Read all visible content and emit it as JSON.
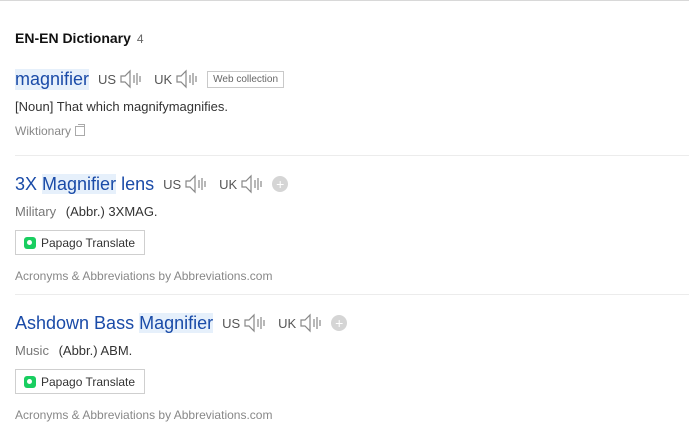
{
  "section": {
    "title": "EN-EN Dictionary",
    "count": "4"
  },
  "entries": [
    {
      "headword": "magnifier",
      "us_label": "US",
      "uk_label": "UK",
      "badge": "Web collection",
      "pos": "[Noun]",
      "definition": "That which magnifymagnifies.",
      "source": "Wiktionary"
    },
    {
      "headword_pre": "3X ",
      "headword_hl": "Magnifier",
      "headword_post": " lens",
      "us_label": "US",
      "uk_label": "UK",
      "plus": "+",
      "field": "Military",
      "definition": "(Abbr.) 3XMAG.",
      "papago": "Papago Translate",
      "provider": "Acronyms & Abbreviations by Abbreviations.com"
    },
    {
      "headword_pre": "Ashdown Bass ",
      "headword_hl": "Magnifier",
      "headword_post": "",
      "us_label": "US",
      "uk_label": "UK",
      "plus": "+",
      "field": "Music",
      "definition": "(Abbr.) ABM.",
      "papago": "Papago Translate",
      "provider": "Acronyms & Abbreviations by Abbreviations.com"
    }
  ]
}
